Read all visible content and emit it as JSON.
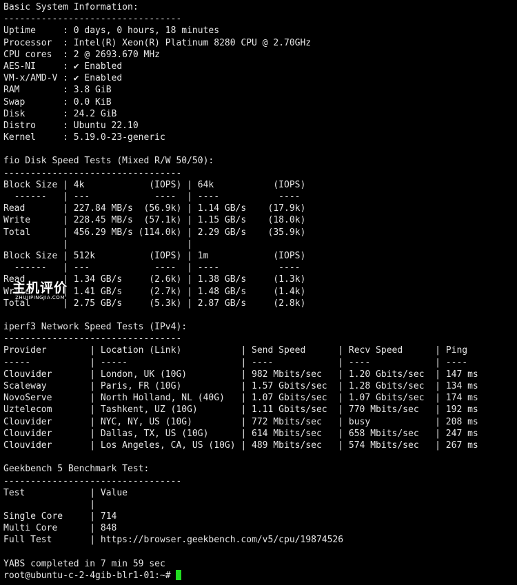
{
  "terminal": {
    "lines": [
      "Basic System Information:",
      "---------------------------------",
      "Uptime     : 0 days, 0 hours, 18 minutes",
      "Processor  : Intel(R) Xeon(R) Platinum 8280 CPU @ 2.70GHz",
      "CPU cores  : 2 @ 2693.670 MHz",
      "AES-NI     : ✔ Enabled",
      "VM-x/AMD-V : ✔ Enabled",
      "RAM        : 3.8 GiB",
      "Swap       : 0.0 KiB",
      "Disk       : 24.2 GiB",
      "Distro     : Ubuntu 22.10",
      "Kernel     : 5.19.0-23-generic",
      "",
      "fio Disk Speed Tests (Mixed R/W 50/50):",
      "---------------------------------",
      "Block Size | 4k            (IOPS) | 64k           (IOPS)",
      "  ------   | ---            ----  | ----           ----",
      "Read       | 227.84 MB/s  (56.9k) | 1.14 GB/s    (17.9k)",
      "Write      | 228.45 MB/s  (57.1k) | 1.15 GB/s    (18.0k)",
      "Total      | 456.29 MB/s (114.0k) | 2.29 GB/s    (35.9k)",
      "           |                      |",
      "Block Size | 512k          (IOPS) | 1m            (IOPS)",
      "  ------   | ---            ----  | ----           ----",
      "Read       | 1.34 GB/s     (2.6k) | 1.38 GB/s     (1.3k)",
      "Write      | 1.41 GB/s     (2.7k) | 1.48 GB/s     (1.4k)",
      "Total      | 2.75 GB/s     (5.3k) | 2.87 GB/s     (2.8k)",
      "",
      "iperf3 Network Speed Tests (IPv4):",
      "---------------------------------",
      "Provider        | Location (Link)           | Send Speed      | Recv Speed      | Ping",
      "-----           | -----                     | ----            | ----            | ----",
      "Clouvider       | London, UK (10G)          | 982 Mbits/sec   | 1.20 Gbits/sec  | 147 ms",
      "Scaleway        | Paris, FR (10G)           | 1.57 Gbits/sec  | 1.28 Gbits/sec  | 134 ms",
      "NovoServe       | North Holland, NL (40G)   | 1.07 Gbits/sec  | 1.07 Gbits/sec  | 174 ms",
      "Uztelecom       | Tashkent, UZ (10G)        | 1.11 Gbits/sec  | 770 Mbits/sec   | 192 ms",
      "Clouvider       | NYC, NY, US (10G)         | 772 Mbits/sec   | busy            | 208 ms",
      "Clouvider       | Dallas, TX, US (10G)      | 614 Mbits/sec   | 658 Mbits/sec   | 247 ms",
      "Clouvider       | Los Angeles, CA, US (10G) | 489 Mbits/sec   | 574 Mbits/sec   | 267 ms",
      "",
      "Geekbench 5 Benchmark Test:",
      "---------------------------------",
      "Test            | Value",
      "                |",
      "Single Core     | 714",
      "Multi Core      | 848",
      "Full Test       | https://browser.geekbench.com/v5/cpu/19874526",
      "",
      "YABS completed in 7 min 59 sec"
    ],
    "prompt": "root@ubuntu-c-2-4gib-blr1-01:~# "
  },
  "watermark": {
    "title": "主机评价",
    "subtitle": "ZHUJIPINGJIA.COM"
  },
  "colors": {
    "background": "#000000",
    "text": "#e6e6e6",
    "cursor": "#22dd22"
  }
}
